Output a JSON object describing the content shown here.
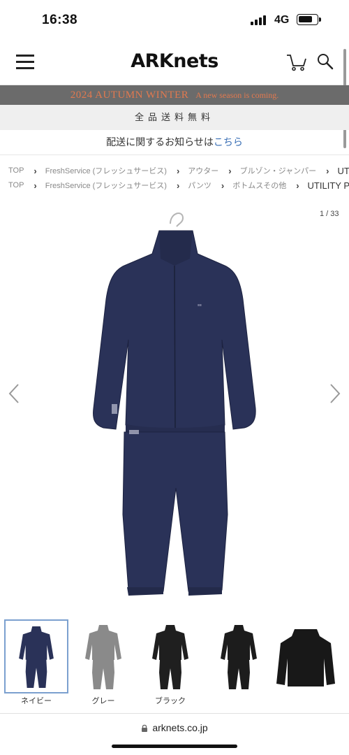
{
  "status_bar": {
    "time": "16:38",
    "network": "4G"
  },
  "header": {
    "logo": "ARKnets"
  },
  "banner": {
    "title": "2024 AUTUMN WINTER",
    "subtitle": "A new season is coming."
  },
  "free_shipping": "全品送料無料",
  "notice": {
    "text": "配送に関するお知らせは",
    "link": "こちら"
  },
  "breadcrumbs": [
    [
      "TOP",
      "FreshService (フレッシュサービス)",
      "アウター",
      "ブルゾン・ジャンパー",
      "UTILITY PA"
    ],
    [
      "TOP",
      "FreshService (フレッシュサービス)",
      "パンツ",
      "ボトムスその他",
      "UTILITY PA"
    ]
  ],
  "gallery": {
    "counter": "1 / 33"
  },
  "thumbnails": [
    {
      "label": "ネイビー",
      "color": "#2a3258",
      "selected": true
    },
    {
      "label": "グレー",
      "color": "#8a8a8a",
      "selected": false
    },
    {
      "label": "ブラック",
      "color": "#1f1f1f",
      "selected": false
    },
    {
      "label": "",
      "color": "#1c1c1c",
      "selected": false
    },
    {
      "label": "",
      "color": "#181818",
      "selected": false
    }
  ],
  "url_bar": {
    "url": "arknets.co.jp"
  },
  "colors": {
    "navy": "#2a3258",
    "banner_text": "#e2794f",
    "link": "#3a6fb5"
  }
}
